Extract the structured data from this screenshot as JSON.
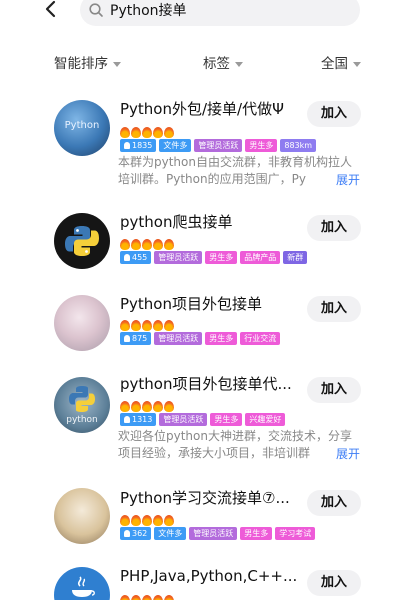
{
  "search": {
    "query": "Python接单"
  },
  "filters": [
    {
      "label": "智能排序"
    },
    {
      "label": "标签"
    },
    {
      "label": "全国"
    }
  ],
  "colors": {
    "accent": "#3d7df5",
    "flame": "#f26522",
    "join_bg": "#f1f1f3"
  },
  "groups": [
    {
      "title": "Python外包/接单/代做Ψ",
      "flames": 5,
      "avatar_text": "Python",
      "tags": [
        {
          "text": "1835",
          "kind": "members"
        },
        {
          "text": "文件多",
          "kind": "blue"
        },
        {
          "text": "管理员活跃",
          "kind": "purple"
        },
        {
          "text": "男生多",
          "kind": "pink"
        },
        {
          "text": "883km",
          "kind": "violet"
        }
      ],
      "desc_lines": [
        "本群为python自由交流群，非教育机构拉人",
        "培训群。Python的应用范围广，Py"
      ],
      "expand": "展开",
      "join": "加入"
    },
    {
      "title": "python爬虫接单",
      "flames": 5,
      "avatar_text": "",
      "tags": [
        {
          "text": "455",
          "kind": "members"
        },
        {
          "text": "管理员活跃",
          "kind": "purple"
        },
        {
          "text": "男生多",
          "kind": "pink"
        },
        {
          "text": "品牌产品",
          "kind": "pink"
        },
        {
          "text": "新群",
          "kind": "lav"
        }
      ],
      "desc_lines": [],
      "expand": "",
      "join": "加入"
    },
    {
      "title": "Python项目外包接单",
      "flames": 5,
      "avatar_text": "",
      "tags": [
        {
          "text": "875",
          "kind": "members"
        },
        {
          "text": "管理员活跃",
          "kind": "purple"
        },
        {
          "text": "男生多",
          "kind": "pink"
        },
        {
          "text": "行业交流",
          "kind": "pink"
        }
      ],
      "desc_lines": [],
      "expand": "",
      "join": "加入"
    },
    {
      "title": "python项目外包接单代...",
      "flames": 5,
      "avatar_text": "python",
      "tags": [
        {
          "text": "1313",
          "kind": "members"
        },
        {
          "text": "管理员活跃",
          "kind": "purple"
        },
        {
          "text": "男生多",
          "kind": "pink"
        },
        {
          "text": "兴趣爱好",
          "kind": "pink"
        }
      ],
      "desc_lines": [
        "欢迎各位python大神进群，交流技术，分享",
        "项目经验，承接大小项目，非培训群"
      ],
      "expand": "展开",
      "join": "加入"
    },
    {
      "title": "Python学习交流接单⑦...",
      "flames": 5,
      "avatar_text": "",
      "tags": [
        {
          "text": "362",
          "kind": "members"
        },
        {
          "text": "文件多",
          "kind": "blue"
        },
        {
          "text": "管理员活跃",
          "kind": "purple"
        },
        {
          "text": "男生多",
          "kind": "pink"
        },
        {
          "text": "学习考试",
          "kind": "pink"
        }
      ],
      "desc_lines": [],
      "expand": "",
      "join": "加入"
    },
    {
      "title": "PHP,Java,Python,C++...",
      "flames": 5,
      "avatar_text": "",
      "tags": [],
      "desc_lines": [],
      "expand": "",
      "join": "加入"
    }
  ]
}
